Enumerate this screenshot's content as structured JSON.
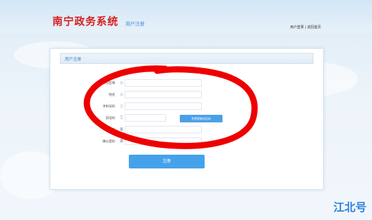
{
  "header": {
    "brand": "南宁政务系统",
    "brand_sub": "",
    "tab": "用户注册",
    "links": [
      "用户登录",
      "返回首页"
    ]
  },
  "form": {
    "title": "用户注册",
    "notice": "",
    "fields": [
      {
        "label": "所在区域",
        "icon": "location-icon",
        "value": "",
        "placeholder": ""
      },
      {
        "label": "姓名",
        "icon": "user-icon",
        "value": "",
        "placeholder": ""
      },
      {
        "label": "手机号码",
        "icon": "phone-icon",
        "value": "",
        "placeholder": ""
      },
      {
        "label": "验证码",
        "icon": "key-icon",
        "value": "",
        "placeholder": ""
      },
      {
        "label": "密码",
        "icon": "lock-icon",
        "value": "",
        "placeholder": ""
      },
      {
        "label": "确认密码",
        "icon": "lock-icon",
        "value": "",
        "placeholder": ""
      }
    ],
    "get_code_label": "免费获取验证码",
    "submit_label": "注册"
  },
  "footer": "",
  "watermark": "江北号",
  "colors": {
    "brand_red": "#d81e1e",
    "accent_blue": "#45a2ea",
    "annotation_red": "#ee0000"
  }
}
